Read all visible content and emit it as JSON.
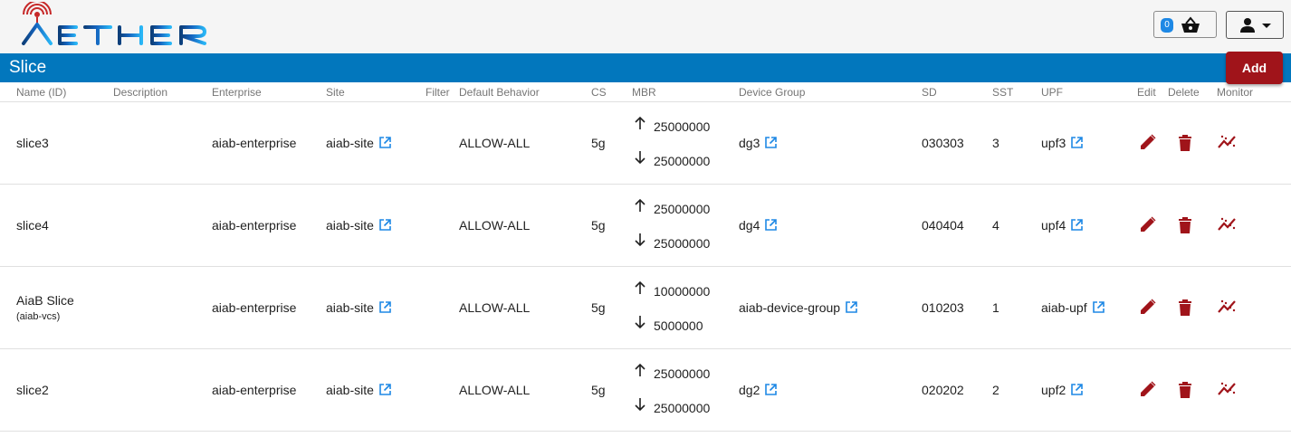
{
  "app": {
    "logo_text": "AETHER",
    "basket_count": "0",
    "brand_color": "#0277bd",
    "accent_color": "#a0141a",
    "link_color": "#1e88e5"
  },
  "page": {
    "title": "Slice",
    "add_label": "Add"
  },
  "table": {
    "headers": {
      "name": "Name (ID)",
      "description": "Description",
      "enterprise": "Enterprise",
      "site": "Site",
      "filter": "Filter",
      "default_behavior": "Default Behavior",
      "cs": "CS",
      "mbr": "MBR",
      "device_group": "Device Group",
      "sd": "SD",
      "sst": "SST",
      "upf": "UPF",
      "edit": "Edit",
      "delete": "Delete",
      "monitor": "Monitor"
    },
    "rows": [
      {
        "name": "slice3",
        "id": "",
        "enterprise": "aiab-enterprise",
        "site": "aiab-site",
        "behavior": "ALLOW-ALL",
        "cs": "5g",
        "mbr_up": "25000000",
        "mbr_down": "25000000",
        "device_group": "dg3",
        "sd": "030303",
        "sst": "3",
        "upf": "upf3"
      },
      {
        "name": "slice4",
        "id": "",
        "enterprise": "aiab-enterprise",
        "site": "aiab-site",
        "behavior": "ALLOW-ALL",
        "cs": "5g",
        "mbr_up": "25000000",
        "mbr_down": "25000000",
        "device_group": "dg4",
        "sd": "040404",
        "sst": "4",
        "upf": "upf4"
      },
      {
        "name": "AiaB Slice",
        "id": "(aiab-vcs)",
        "enterprise": "aiab-enterprise",
        "site": "aiab-site",
        "behavior": "ALLOW-ALL",
        "cs": "5g",
        "mbr_up": "10000000",
        "mbr_down": "5000000",
        "device_group": "aiab-device-group",
        "sd": "010203",
        "sst": "1",
        "upf": "aiab-upf"
      },
      {
        "name": "slice2",
        "id": "",
        "enterprise": "aiab-enterprise",
        "site": "aiab-site",
        "behavior": "ALLOW-ALL",
        "cs": "5g",
        "mbr_up": "25000000",
        "mbr_down": "25000000",
        "device_group": "dg2",
        "sd": "020202",
        "sst": "2",
        "upf": "upf2"
      }
    ]
  }
}
